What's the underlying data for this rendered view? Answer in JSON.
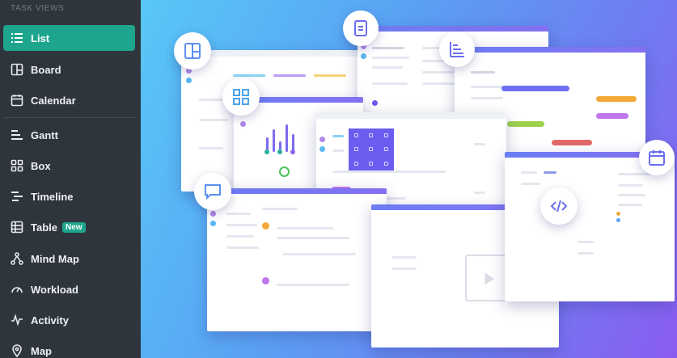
{
  "sidebar": {
    "heading": "TASK VIEWS",
    "items": [
      {
        "label": "List",
        "icon": "list-icon",
        "active": true
      },
      {
        "label": "Board",
        "icon": "board-icon"
      },
      {
        "label": "Calendar",
        "icon": "calendar-icon"
      },
      {
        "label": "Gantt",
        "icon": "gantt-icon"
      },
      {
        "label": "Box",
        "icon": "box-icon"
      },
      {
        "label": "Timeline",
        "icon": "timeline-icon"
      },
      {
        "label": "Table",
        "icon": "table-icon",
        "badge": "New"
      },
      {
        "label": "Mind Map",
        "icon": "mind-map-icon"
      },
      {
        "label": "Workload",
        "icon": "workload-icon"
      },
      {
        "label": "Activity",
        "icon": "activity-icon"
      },
      {
        "label": "Map",
        "icon": "map-pin-icon"
      }
    ]
  },
  "colors": {
    "accent": "#1ea58d",
    "sidebar_bg": "#2f353c",
    "hero_start": "#58c8f6",
    "hero_end": "#8a5cf0"
  }
}
